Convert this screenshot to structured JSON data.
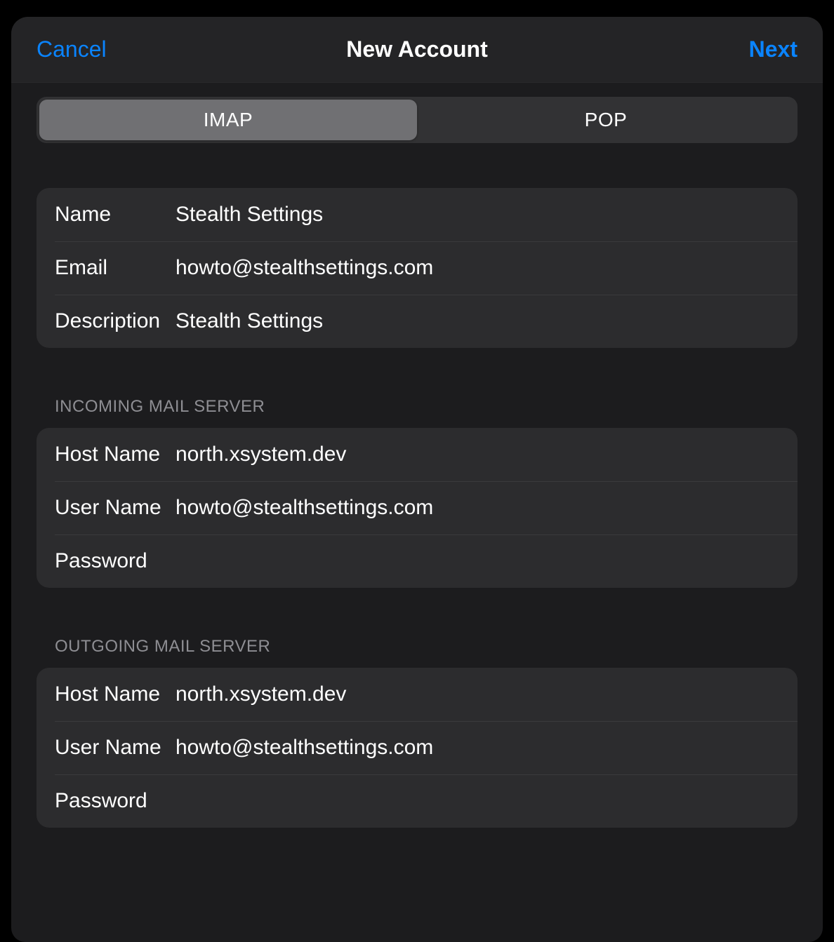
{
  "nav": {
    "cancel": "Cancel",
    "title": "New Account",
    "next": "Next"
  },
  "tabs": {
    "imap": "IMAP",
    "pop": "POP"
  },
  "account": {
    "name_label": "Name",
    "name_value": "Stealth Settings",
    "email_label": "Email",
    "email_value": "howto@stealthsettings.com",
    "description_label": "Description",
    "description_value": "Stealth Settings"
  },
  "incoming": {
    "header": "Incoming Mail Server",
    "host_label": "Host Name",
    "host_value": "north.xsystem.dev",
    "user_label": "User Name",
    "user_value": "howto@stealthsettings.com",
    "password_label": "Password",
    "password_value": ""
  },
  "outgoing": {
    "header": "Outgoing Mail Server",
    "host_label": "Host Name",
    "host_value": "north.xsystem.dev",
    "user_label": "User Name",
    "user_value": "howto@stealthsettings.com",
    "password_label": "Password",
    "password_value": ""
  }
}
